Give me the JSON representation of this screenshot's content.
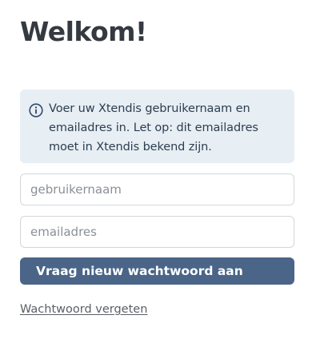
{
  "page": {
    "title": "Welkom!"
  },
  "info": {
    "icon": "info-circle-icon",
    "text": "Voer uw Xtendis gebruikernaam en emailadres in. Let op: dit emailadres moet in Xtendis bekend zijn."
  },
  "form": {
    "username": {
      "value": "",
      "placeholder": "gebruikernaam"
    },
    "email": {
      "value": "",
      "placeholder": "emailadres"
    },
    "submit_label": "Vraag nieuw wachtwoord aan",
    "forgot_label": "Wachtwoord vergeten"
  },
  "colors": {
    "info_bg": "#e7eef4",
    "button_bg": "#4a6587",
    "text_dark": "#343a40"
  }
}
